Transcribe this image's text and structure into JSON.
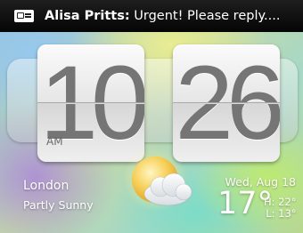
{
  "notification": {
    "icon": "message-icon",
    "sender": "Alisa Pritts:",
    "text": " Urgent! Please reply...."
  },
  "clock": {
    "hour": "10",
    "minute": "26",
    "ampm": "AM"
  },
  "weather": {
    "city": "London",
    "condition": "Partly Sunny",
    "date": "Wed, Aug 18",
    "temperature": "17°",
    "high": "H: 22°",
    "low": "L: 13°",
    "icon": "partly-sunny-icon"
  },
  "colors": {
    "status_bar": "#0a0a0a",
    "digit": "#757575",
    "sun": "#f5c542"
  }
}
